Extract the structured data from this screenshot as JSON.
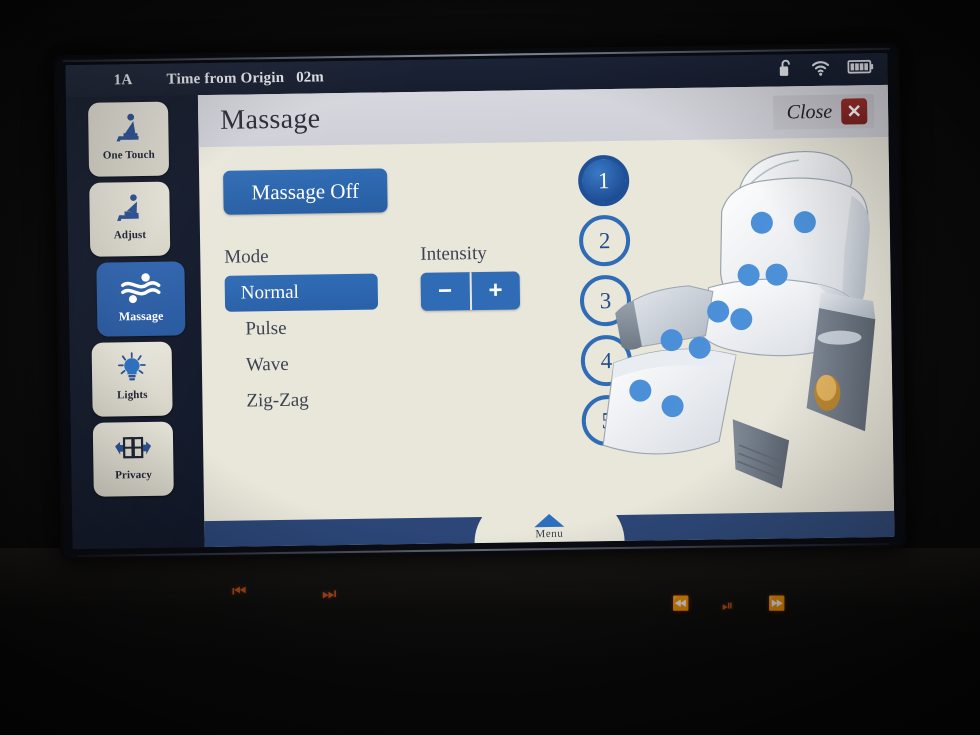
{
  "status_bar": {
    "seat": "1A",
    "time_label": "Time from Origin",
    "time_value": "02m",
    "icons": [
      "padlock-unlocked-icon",
      "wifi-icon",
      "battery-icon"
    ],
    "battery_bars": 4
  },
  "sidebar": {
    "items": [
      {
        "label": "One Touch",
        "icon": "seat-upright-icon",
        "active": false
      },
      {
        "label": "Adjust",
        "icon": "seat-recline-icon",
        "active": false
      },
      {
        "label": "Massage",
        "icon": "massage-waves-icon",
        "active": true
      },
      {
        "label": "Lights",
        "icon": "lightbulb-icon",
        "active": false
      },
      {
        "label": "Privacy",
        "icon": "privacy-panels-icon",
        "active": false
      }
    ]
  },
  "header": {
    "title": "Massage",
    "close_label": "Close",
    "close_glyph": "✕"
  },
  "controls": {
    "power_button": "Massage Off",
    "mode_label": "Mode",
    "modes": [
      {
        "label": "Normal",
        "selected": true
      },
      {
        "label": "Pulse",
        "selected": false
      },
      {
        "label": "Wave",
        "selected": false
      },
      {
        "label": "Zig-Zag",
        "selected": false
      }
    ],
    "intensity_label": "Intensity",
    "intensity_minus": "−",
    "intensity_plus": "+"
  },
  "zones": [
    {
      "label": "1",
      "selected": true
    },
    {
      "label": "2",
      "selected": false
    },
    {
      "label": "3",
      "selected": false
    },
    {
      "label": "4",
      "selected": false
    },
    {
      "label": "5",
      "selected": false
    }
  ],
  "bottom": {
    "menu_label": "Menu"
  },
  "handset_keys": [
    {
      "name": "previous-track-button",
      "glyph": "⏮"
    },
    {
      "name": "next-track-button",
      "glyph": "⏭"
    },
    {
      "name": "rewind-button",
      "glyph": "⏪"
    },
    {
      "name": "play-pause-button",
      "glyph": "⏯"
    },
    {
      "name": "fast-forward-button",
      "glyph": "⏩"
    }
  ],
  "colors": {
    "accent_blue": "#2f6cb5",
    "deep_blue": "#1f4f97",
    "panel_cream": "#e9e6da",
    "header_grey": "#d7d7de",
    "status_navy": "#1c2438",
    "bottom_navy": "#2b4677",
    "close_red": "#9c2e2b",
    "key_orange": "#c2551f",
    "massage_dot": "#4a8fd8"
  }
}
